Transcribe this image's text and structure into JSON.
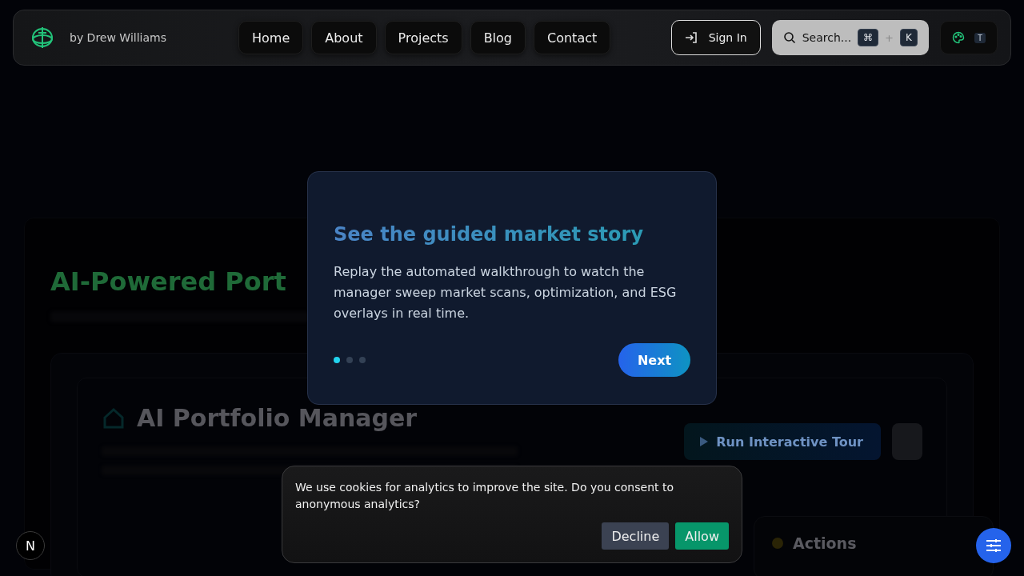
{
  "header": {
    "byline": "by Drew Williams",
    "nav": [
      {
        "label": "Home"
      },
      {
        "label": "About"
      },
      {
        "label": "Projects"
      },
      {
        "label": "Blog"
      },
      {
        "label": "Contact"
      }
    ],
    "sign_in": "Sign In",
    "search": {
      "label": "Search...",
      "keys": [
        "⌘",
        "K"
      ],
      "joiner": "+"
    },
    "theme_key": "T"
  },
  "background": {
    "heading": "AI-Powered Port",
    "card_title": "AI Portfolio Manager",
    "tour_button": "Run Interactive Tour",
    "actions_title": "Actions"
  },
  "tour_modal": {
    "title": "See the guided market story",
    "body": "Replay the automated walkthrough to watch the manager sweep market scans, optimization, and ESG overlays in real time.",
    "steps": [
      {
        "selected": true
      },
      {
        "selected": false
      },
      {
        "selected": false
      }
    ],
    "next": "Next"
  },
  "cookie_banner": {
    "message": "We use cookies for analytics to improve the site. Do you consent to anonymous analytics?",
    "buttons": [
      {
        "label": "Decline",
        "kind": "secondary"
      },
      {
        "label": "Allow",
        "kind": "primary"
      }
    ]
  },
  "dev_badge": "N"
}
